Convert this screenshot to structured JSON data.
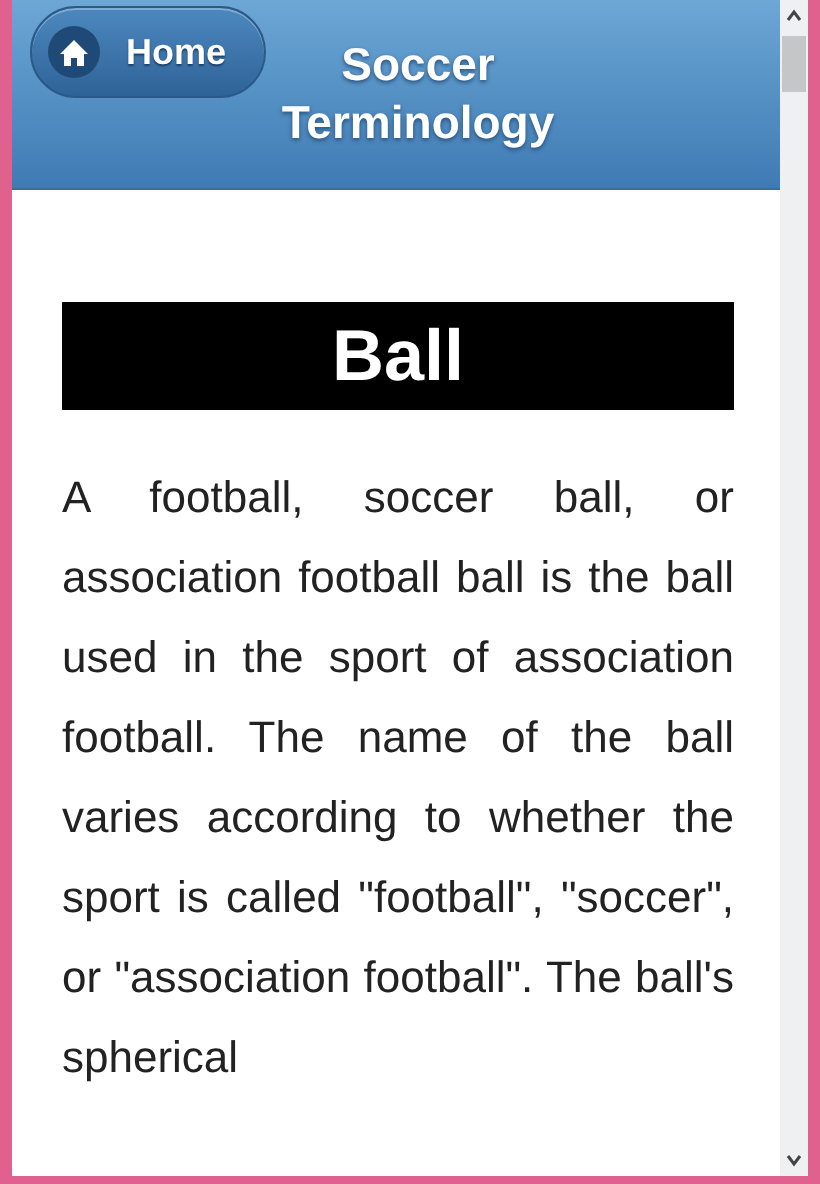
{
  "header": {
    "home_button": "Home",
    "title": "Soccer Terminology"
  },
  "section": {
    "heading": "Ball",
    "paragraph": "A football, soccer ball, or association football ball is the ball used in the sport of association football. The name of the ball varies according to whether the sport is called \"football\", \"soccer\", or \"association football\". The ball's spherical"
  }
}
